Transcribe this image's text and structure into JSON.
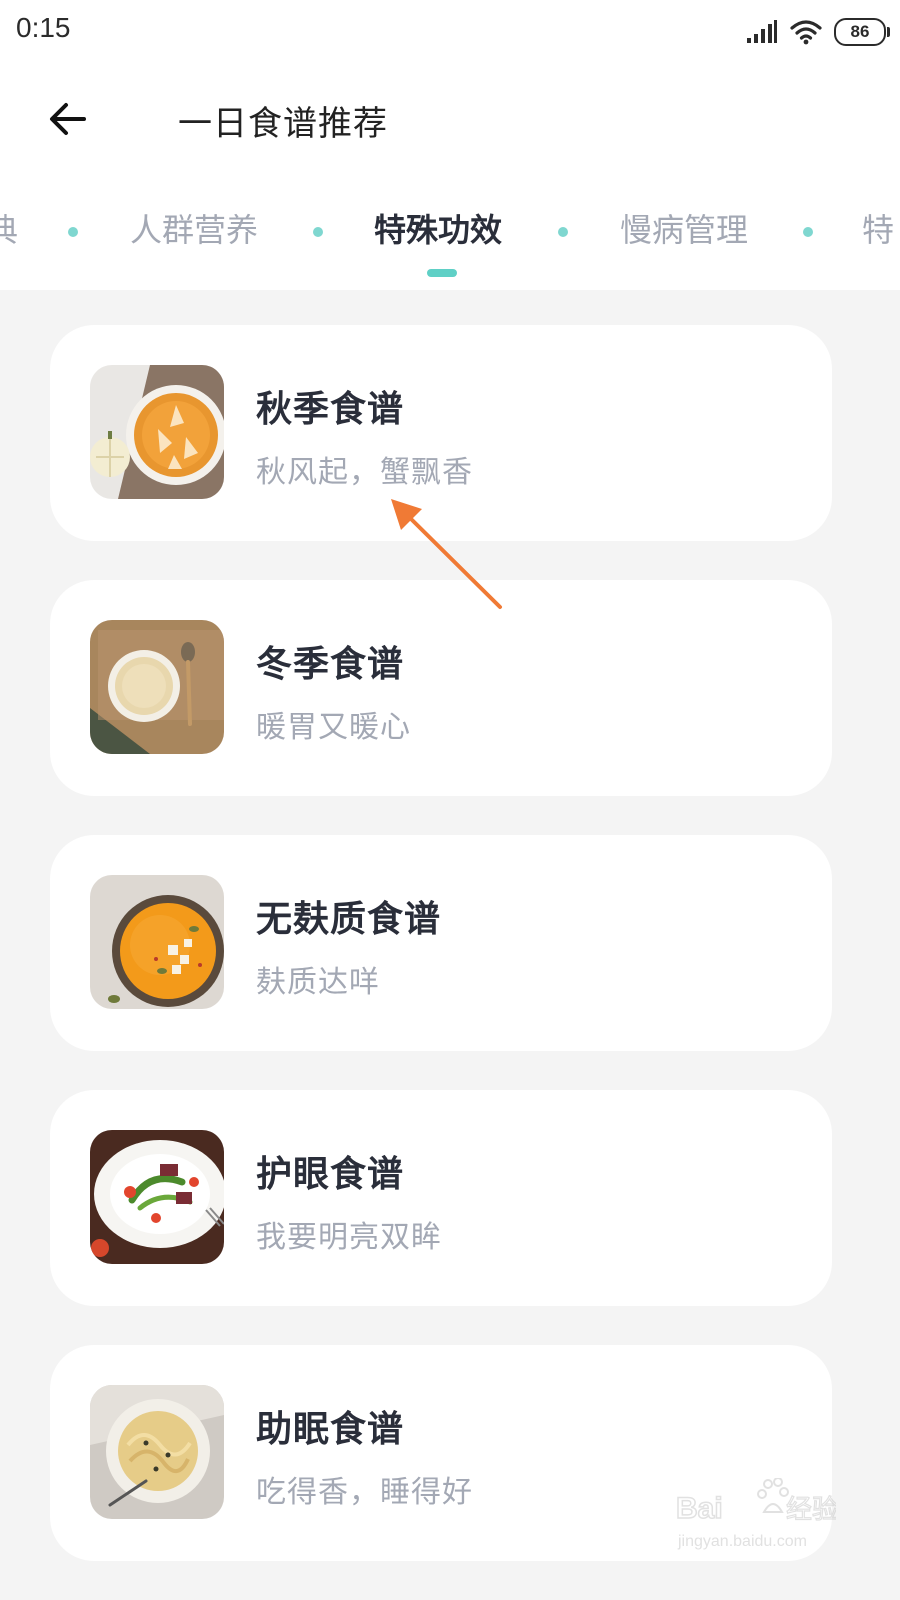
{
  "status_bar": {
    "time": "0:15",
    "battery": "86",
    "icons": [
      "signal-icon",
      "wifi-icon",
      "battery-icon"
    ]
  },
  "header": {
    "title": "一日食谱推荐",
    "back_icon": "arrow-left-icon"
  },
  "tabs": [
    {
      "label": "典",
      "active": false
    },
    {
      "label": "人群营养",
      "active": false
    },
    {
      "label": "特殊功效",
      "active": true
    },
    {
      "label": "慢病管理",
      "active": false
    },
    {
      "label": "特",
      "active": false
    }
  ],
  "cards": [
    {
      "title": "秋季食谱",
      "subtitle": "秋风起，蟹飘香",
      "image": "pumpkin-pie-image"
    },
    {
      "title": "冬季食谱",
      "subtitle": "暖胃又暖心",
      "image": "porridge-bowl-image"
    },
    {
      "title": "无麸质食谱",
      "subtitle": "麸质达咩",
      "image": "pumpkin-soup-image"
    },
    {
      "title": "护眼食谱",
      "subtitle": "我要明亮双眸",
      "image": "salad-plate-image"
    },
    {
      "title": "助眠食谱",
      "subtitle": "吃得香，睡得好",
      "image": "pasta-plate-image"
    }
  ],
  "colors": {
    "accent": "#5fd0c6",
    "dot": "#7fd7d0",
    "title": "#2a2e3a",
    "muted": "#a3a8b4",
    "background": "#f4f4f4",
    "annotation_arrow": "#f07a35"
  },
  "watermark": {
    "brand": "Bai du 经验",
    "url": "jingyan.baidu.com"
  }
}
